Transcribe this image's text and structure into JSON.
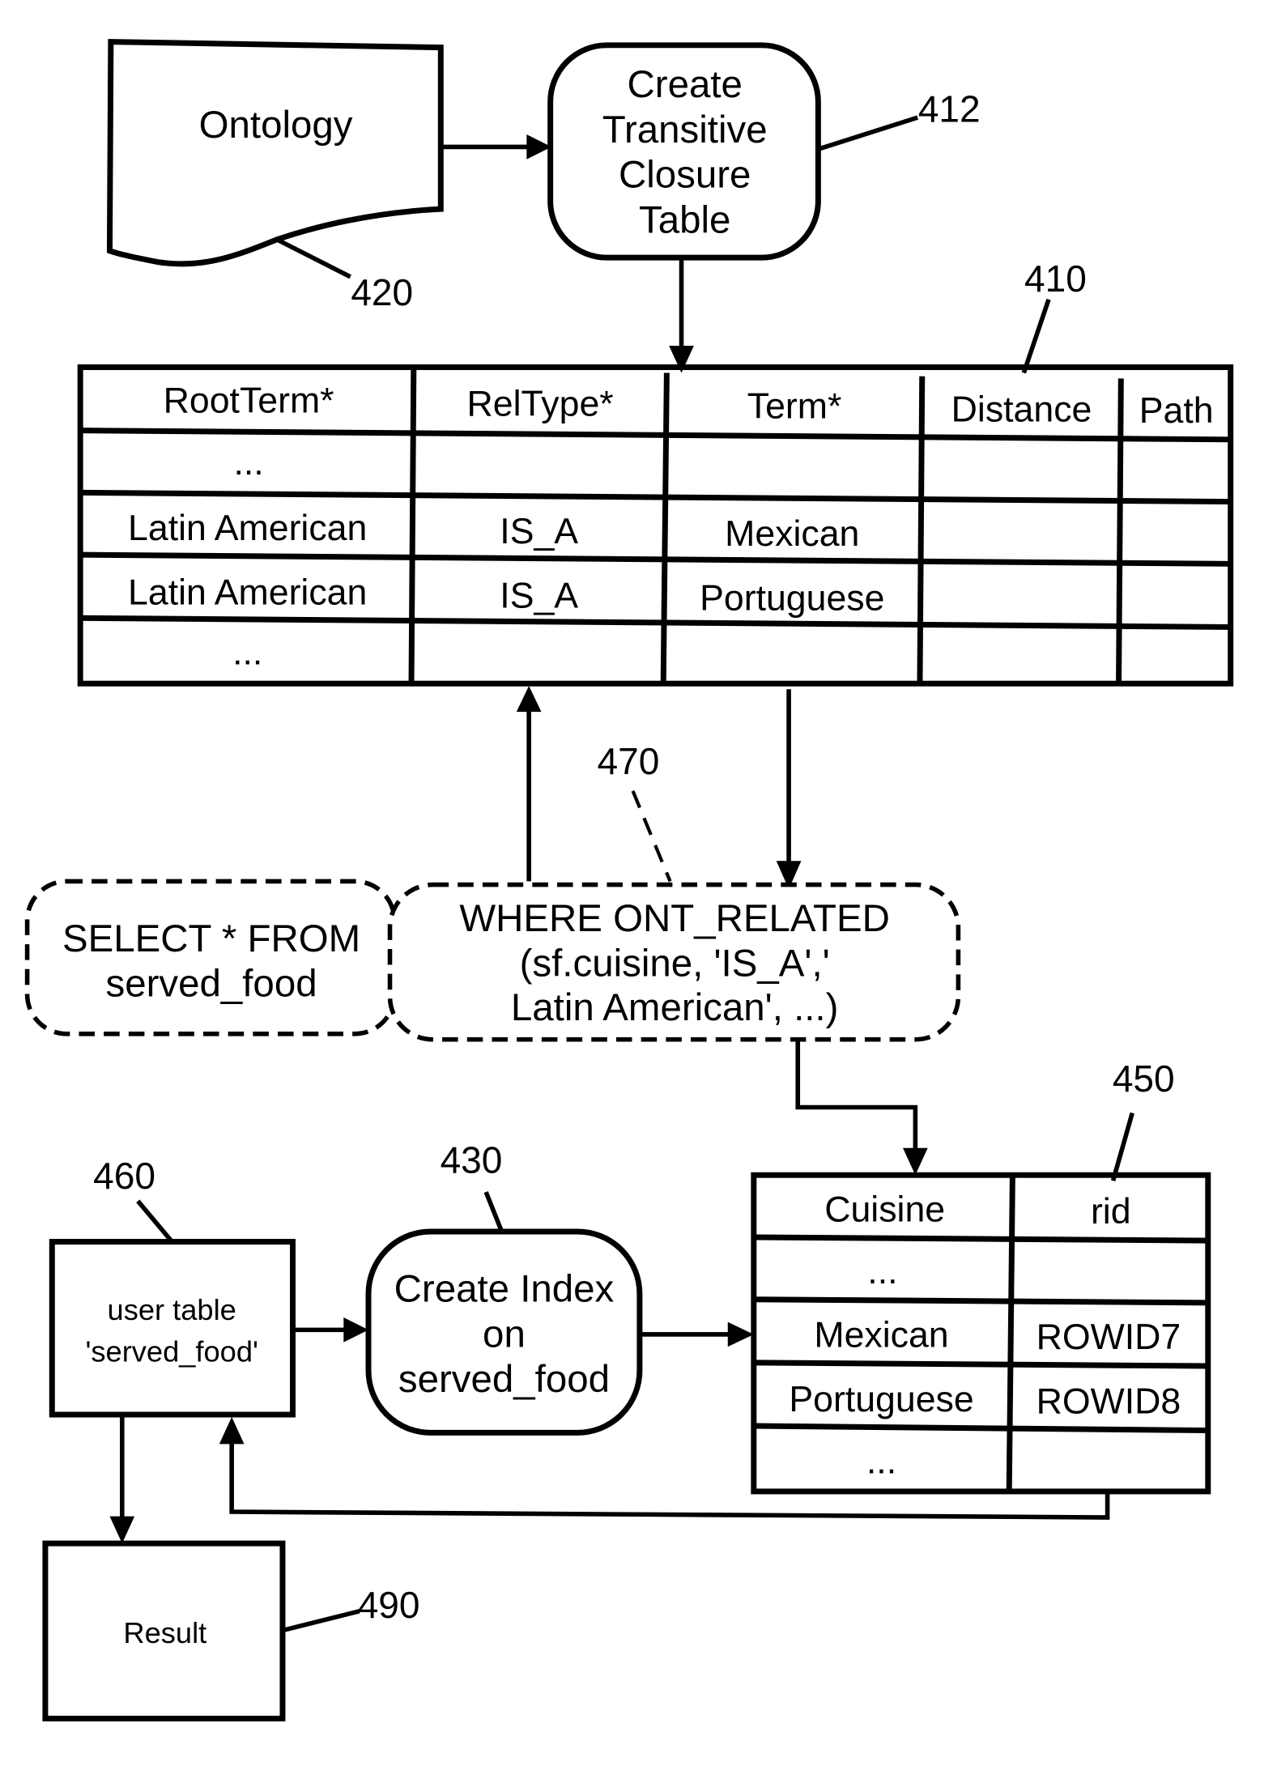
{
  "ontology": {
    "label": "Ontology",
    "ref": "420"
  },
  "create_tc": {
    "lines": [
      "Create",
      "Transitive",
      "Closure",
      "Table"
    ],
    "ref": "412"
  },
  "closure_table": {
    "ref": "410",
    "headers": [
      "RootTerm*",
      "RelType*",
      "Term*",
      "Distance",
      "Path"
    ],
    "rows": [
      [
        "...",
        "",
        "",
        "",
        ""
      ],
      [
        "Latin American",
        "IS_A",
        "Mexican",
        "",
        ""
      ],
      [
        "Latin American",
        "IS_A",
        "Portuguese",
        "",
        ""
      ],
      [
        "...",
        "",
        "",
        "",
        ""
      ]
    ]
  },
  "query": {
    "ref": "470",
    "select_lines": [
      "SELECT * FROM",
      "served_food"
    ],
    "where_lines": [
      "WHERE ONT_RELATED",
      "(sf.cuisine, 'IS_A','",
      "Latin American', ...)"
    ]
  },
  "user_table": {
    "lines": [
      "user table",
      "'served_food'"
    ],
    "ref": "460"
  },
  "create_index": {
    "lines": [
      "Create Index",
      "on",
      "served_food"
    ],
    "ref": "430"
  },
  "index_table": {
    "ref": "450",
    "headers": [
      "Cuisine",
      "rid"
    ],
    "rows": [
      [
        "...",
        ""
      ],
      [
        "Mexican",
        "ROWID7"
      ],
      [
        "Portuguese",
        "ROWID8"
      ],
      [
        "...",
        ""
      ]
    ]
  },
  "result": {
    "label": "Result",
    "ref": "490"
  }
}
